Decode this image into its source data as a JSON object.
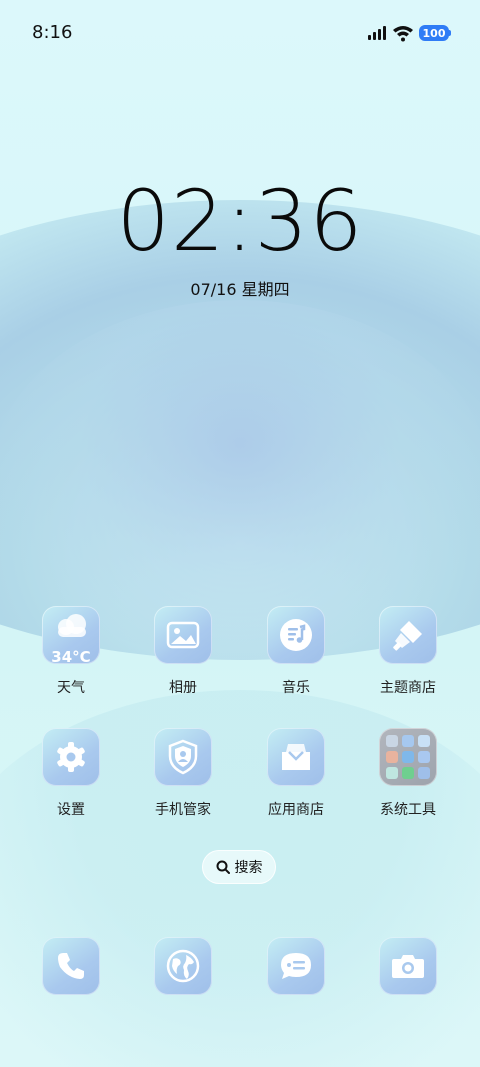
{
  "status_bar": {
    "time": "8:16",
    "battery": "100",
    "battery_color": "#2f7cf6"
  },
  "lock_clock": {
    "time": "02:36",
    "date": "07/16 星期四"
  },
  "apps": {
    "weather": {
      "label": "天气",
      "temp": "34°C",
      "icon": "cloud-icon"
    },
    "gallery": {
      "label": "相册",
      "icon": "photo-icon"
    },
    "music": {
      "label": "音乐",
      "icon": "music-note-icon"
    },
    "theme_store": {
      "label": "主题商店",
      "icon": "brush-icon"
    },
    "settings": {
      "label": "设置",
      "icon": "gear-icon"
    },
    "phone_manager": {
      "label": "手机管家",
      "icon": "shield-icon"
    },
    "app_store": {
      "label": "应用商店",
      "icon": "store-bag-icon"
    },
    "system_tools": {
      "label": "系统工具",
      "icon": "folder-icon"
    }
  },
  "search": {
    "label": "搜索"
  },
  "dock": [
    {
      "name": "phone",
      "icon": "phone-icon"
    },
    {
      "name": "browser",
      "icon": "globe-icon"
    },
    {
      "name": "messages",
      "icon": "message-icon"
    },
    {
      "name": "camera",
      "icon": "camera-icon"
    }
  ],
  "theme": {
    "tile_gradient_start": "#c4eef4",
    "tile_gradient_end": "#9fbfe9",
    "icon_color": "#ffffff"
  }
}
